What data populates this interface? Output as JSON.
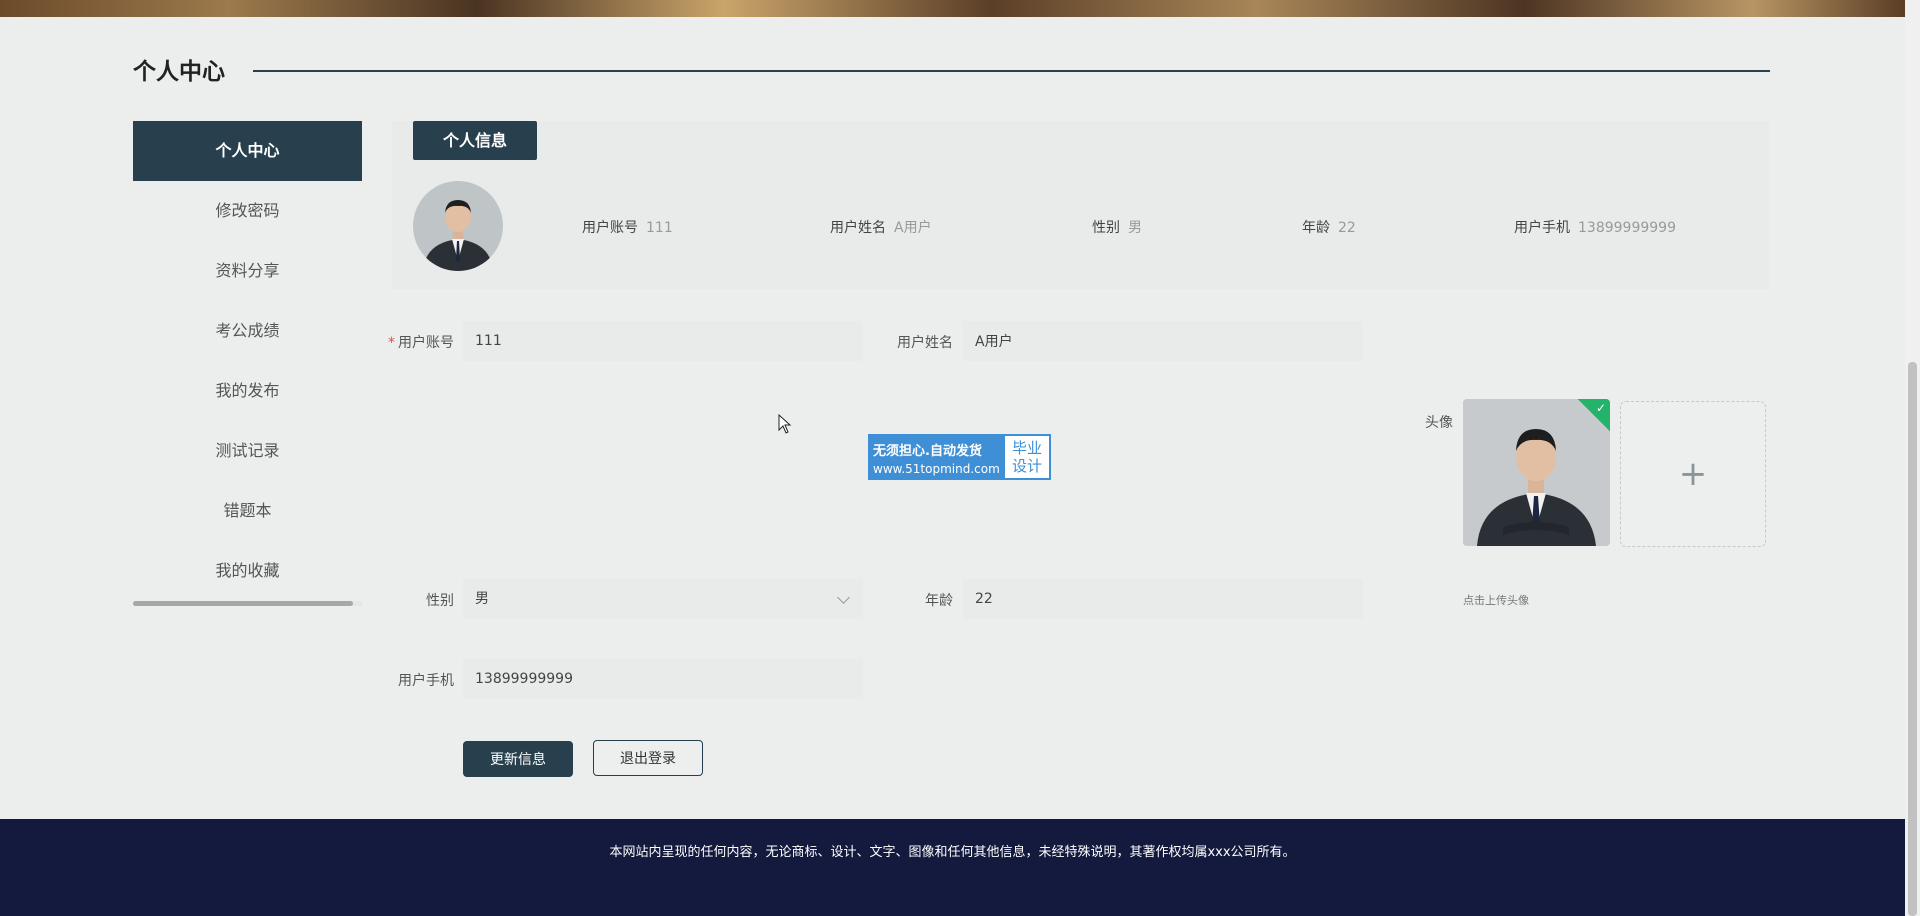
{
  "page": {
    "title": "个人中心"
  },
  "sidebar": {
    "items": [
      {
        "label": "个人中心",
        "active": true
      },
      {
        "label": "修改密码"
      },
      {
        "label": "资料分享"
      },
      {
        "label": "考公成绩"
      },
      {
        "label": "我的发布"
      },
      {
        "label": "测试记录"
      },
      {
        "label": "错题本"
      },
      {
        "label": "我的收藏"
      }
    ]
  },
  "info_card": {
    "tab": "个人信息",
    "fields": [
      {
        "label": "用户账号",
        "value": "111"
      },
      {
        "label": "用户姓名",
        "value": "A用户"
      },
      {
        "label": "性别",
        "value": "男"
      },
      {
        "label": "年龄",
        "value": "22"
      },
      {
        "label": "用户手机",
        "value": "13899999999"
      }
    ]
  },
  "form": {
    "account": {
      "label": "用户账号",
      "value": "111",
      "required": true
    },
    "name": {
      "label": "用户姓名",
      "value": "A用户"
    },
    "avatar": {
      "label": "头像",
      "tip": "点击上传头像"
    },
    "gender": {
      "label": "性别",
      "value": "男"
    },
    "age": {
      "label": "年龄",
      "value": "22"
    },
    "phone": {
      "label": "用户手机",
      "value": "13899999999"
    }
  },
  "buttons": {
    "update": "更新信息",
    "logout": "退出登录"
  },
  "watermark": {
    "main": "无须担心.自动发货",
    "url": "www.51topmind.com",
    "side": "毕业设计"
  },
  "footer": {
    "text": "本网站内呈现的任何内容，无论商标、设计、文字、图像和任何其他信息，未经特殊说明，其著作权均属xxx公司所有。"
  },
  "colors": {
    "primary": "#283f4d",
    "footer_bg": "#131a3d",
    "background": "#eceeed",
    "success": "#23b36b"
  }
}
